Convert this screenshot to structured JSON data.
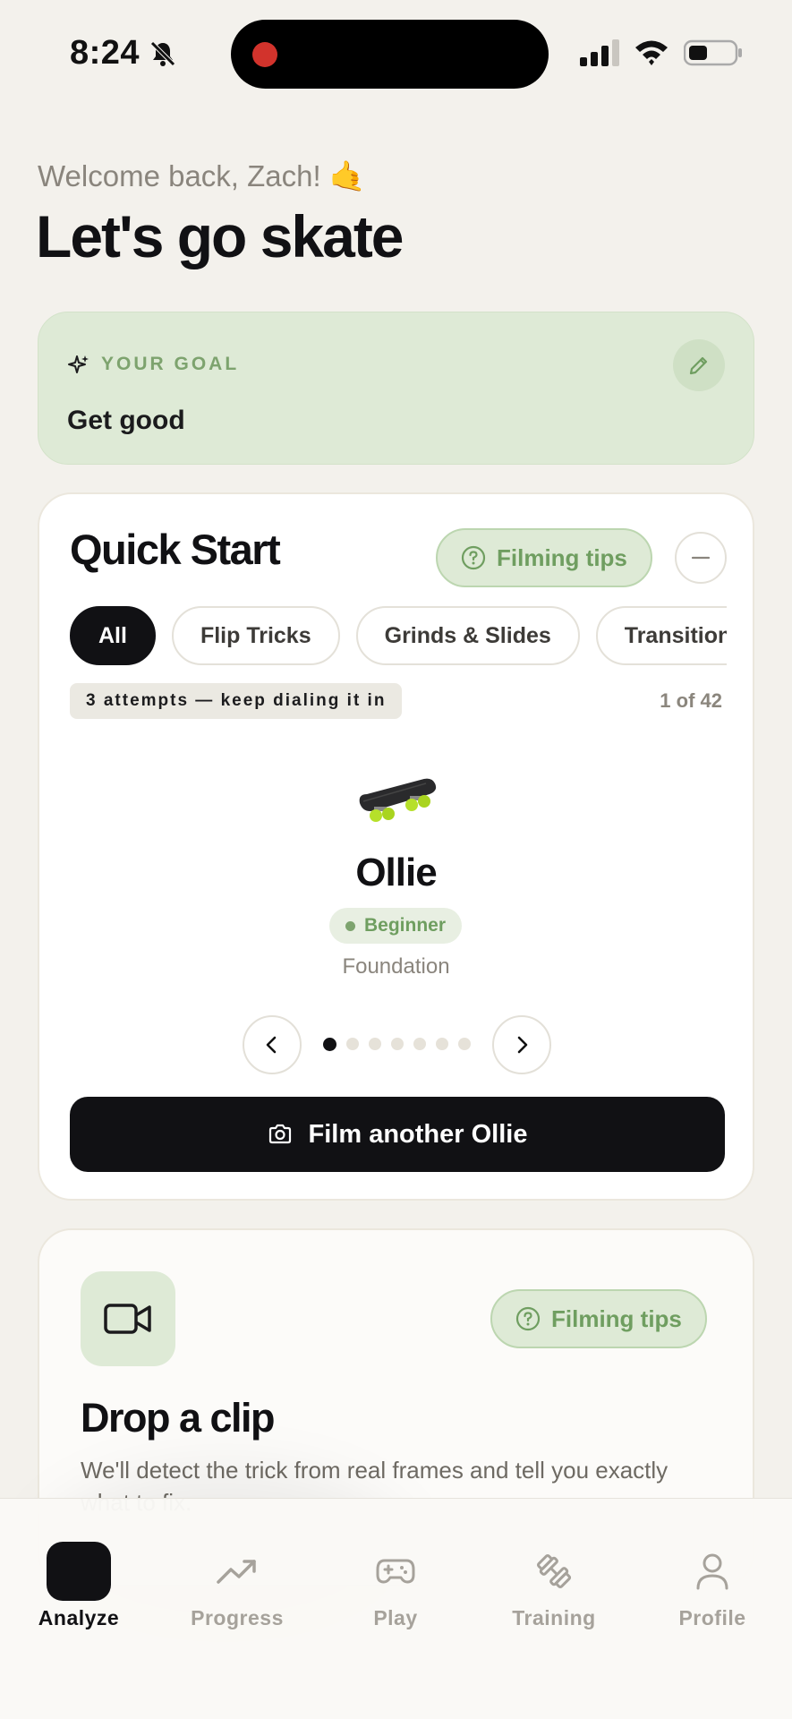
{
  "status_bar": {
    "time": "8:24"
  },
  "header": {
    "welcome": "Welcome back, Zach! 🤙",
    "title": "Let's go skate"
  },
  "goal": {
    "label": "YOUR GOAL",
    "text": "Get good"
  },
  "quick_start": {
    "title": "Quick Start",
    "tips_label": "Filming tips",
    "filters": [
      "All",
      "Flip Tricks",
      "Grinds & Slides",
      "Transition"
    ],
    "attempts": "3 attempts — keep dialing it in",
    "counter": "1 of 42",
    "trick": {
      "name": "Ollie",
      "level": "Beginner",
      "category": "Foundation"
    },
    "pager": {
      "total_dots": 7,
      "active_index": 0
    },
    "film_button": "Film another Ollie"
  },
  "drop_clip": {
    "tips_label": "Filming tips",
    "title": "Drop a clip",
    "description": "We'll detect the trick from real frames and tell you exactly what to fix."
  },
  "tab_bar": {
    "tabs": [
      {
        "label": "Analyze",
        "icon": "analyze-icon",
        "active": true
      },
      {
        "label": "Progress",
        "icon": "trending-up-icon",
        "active": false
      },
      {
        "label": "Play",
        "icon": "gamepad-icon",
        "active": false
      },
      {
        "label": "Training",
        "icon": "dumbbell-icon",
        "active": false
      },
      {
        "label": "Profile",
        "icon": "user-icon",
        "active": false
      }
    ]
  },
  "colors": {
    "accent_green": "#7da36e",
    "goal_bg": "#deead6",
    "primary_dark": "#111114",
    "recording": "#d2332c"
  }
}
